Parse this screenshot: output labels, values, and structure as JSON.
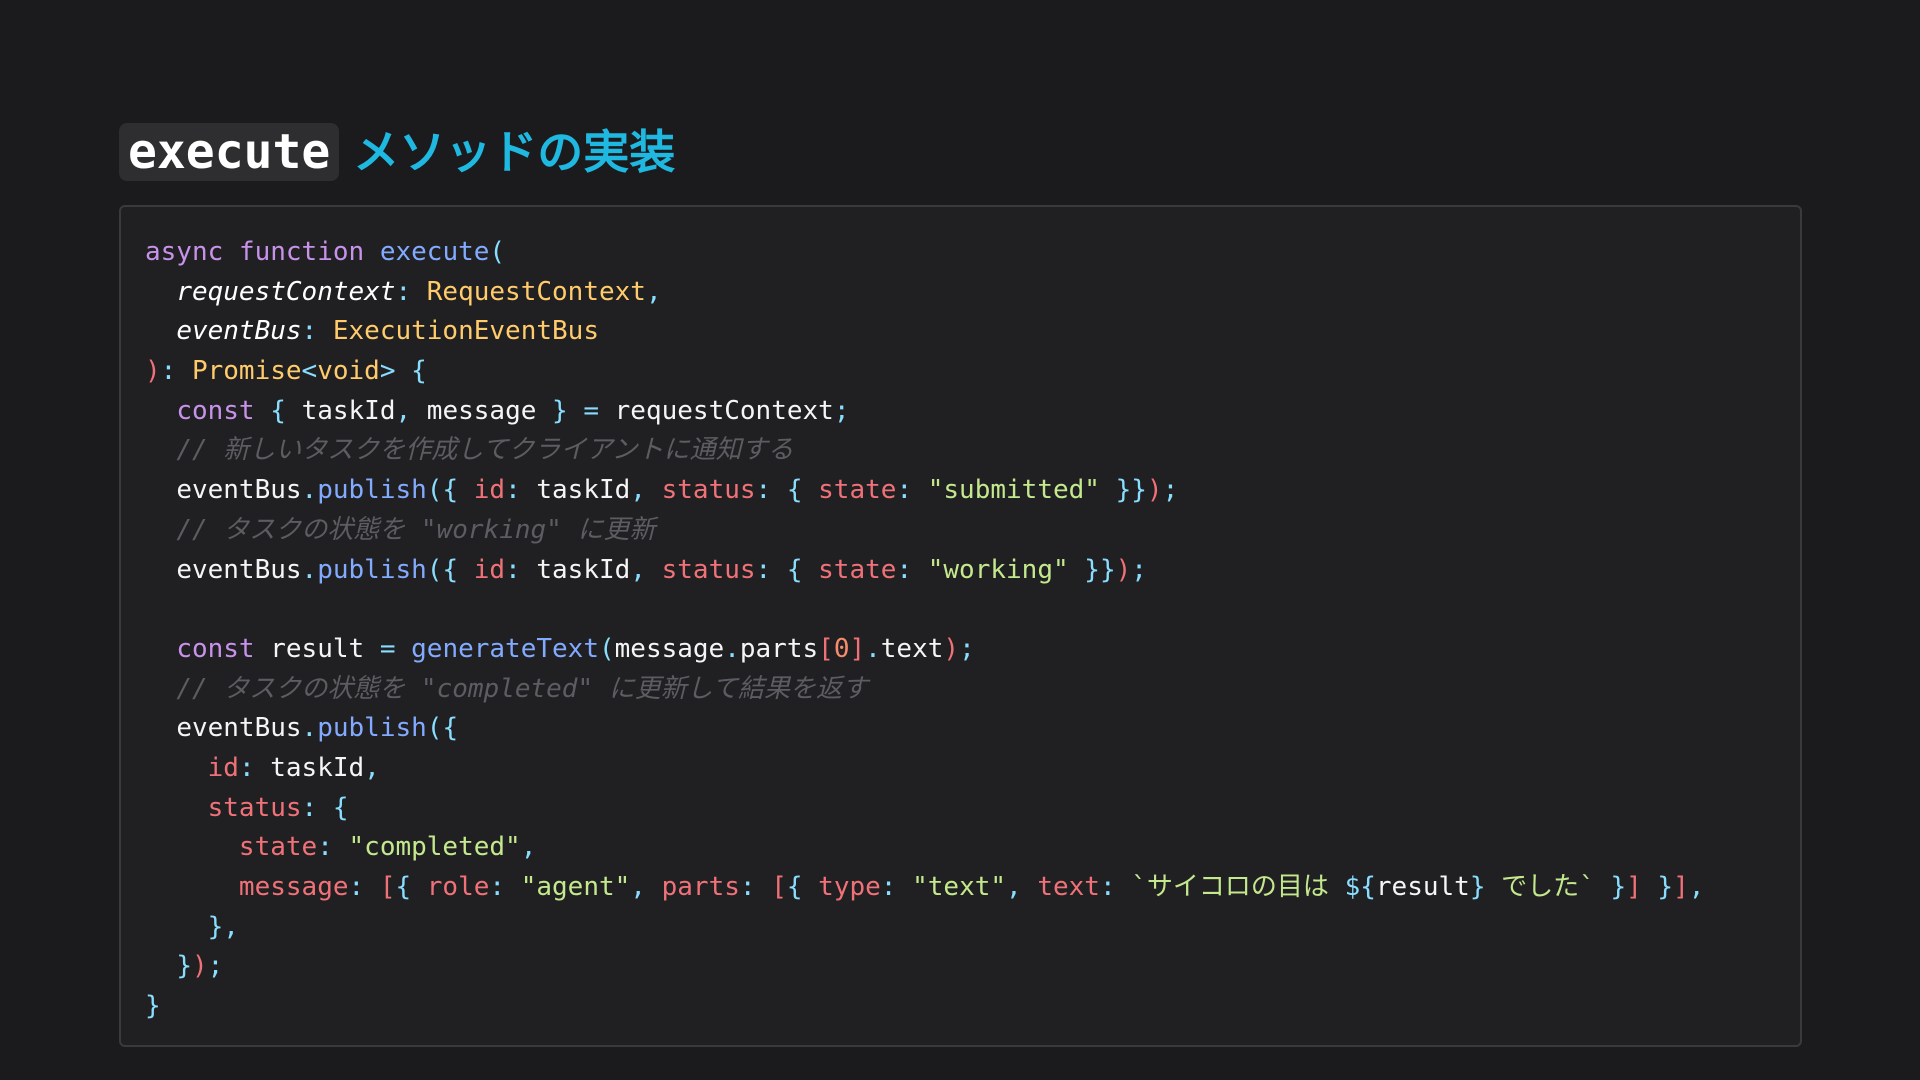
{
  "title": {
    "code": "execute",
    "text": "メソッドの実装"
  },
  "code": {
    "language": "typescript",
    "lines": [
      "async function execute(",
      "  requestContext: RequestContext,",
      "  eventBus: ExecutionEventBus",
      "): Promise<void> {",
      "  const { taskId, message } = requestContext;",
      "  // 新しいタスクを作成してクライアントに通知する",
      "  eventBus.publish({ id: taskId, status: { state: \"submitted\" }});",
      "  // タスクの状態を \"working\" に更新",
      "  eventBus.publish({ id: taskId, status: { state: \"working\" }});",
      "",
      "  const result = generateText(message.parts[0].text);",
      "  // タスクの状態を \"completed\" に更新して結果を返す",
      "  eventBus.publish({",
      "    id: taskId,",
      "    status: {",
      "      state: \"completed\",",
      "      message: [{ role: \"agent\", parts: [{ type: \"text\", text: `サイコロの目は ${result} でした` }] }],",
      "    },",
      "  });",
      "}"
    ]
  },
  "colors": {
    "background": "#1b1b1d",
    "code_background": "#202022",
    "title_accent": "#1fb8e0",
    "keyword": "#c792ea",
    "function": "#82aaff",
    "type": "#ffcb6b",
    "property": "#f07178",
    "string": "#c3e88d",
    "punctuation": "#89ddff",
    "comment": "#5c5c62"
  }
}
